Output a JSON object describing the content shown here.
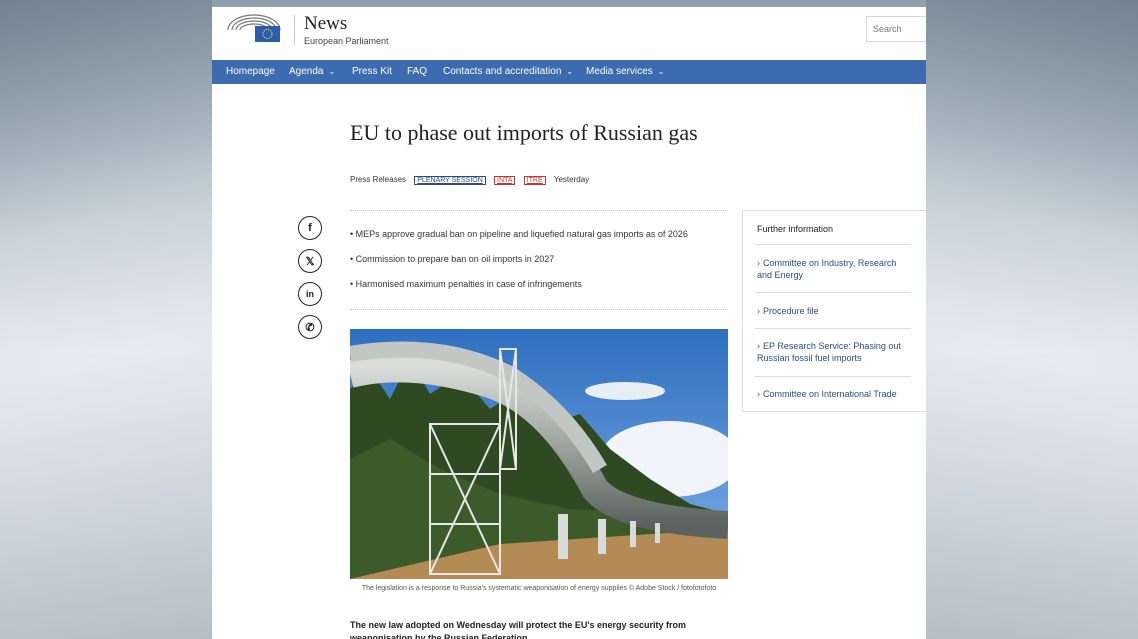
{
  "site": {
    "title": "News",
    "subtitle": "European Parliament"
  },
  "search": {
    "placeholder": "Search"
  },
  "nav": [
    {
      "label": "Homepage"
    },
    {
      "label": "Agenda"
    },
    {
      "label": "Press Kit"
    },
    {
      "label": "FAQ"
    },
    {
      "label": "Contacts and accreditation"
    },
    {
      "label": "Media services"
    }
  ],
  "article": {
    "title": "EU to phase out imports of Russian gas",
    "type": "Press Releases",
    "tags": [
      "PLENARY SESSION",
      "INTA",
      "ITRE"
    ],
    "date": "Yesterday",
    "bullets": [
      "MEPs approve gradual ban on pipeline and liquefied natural gas imports as of 2026",
      "Commission to prepare ban on oil imports in 2027",
      "Harmonised maximum penalties in case of infringements"
    ],
    "image_caption": "The legislation is a response to Russia's systematic weaponisation of energy supplies © Adobe Stock / fotofotofoto",
    "lead": "The new law adopted on Wednesday will protect the EU's energy security from weaponisation by the Russian Federation."
  },
  "share": [
    {
      "icon": "facebook-icon",
      "glyph": "f"
    },
    {
      "icon": "x-icon",
      "glyph": "𝕏"
    },
    {
      "icon": "linkedin-icon",
      "glyph": "in"
    },
    {
      "icon": "whatsapp-icon",
      "glyph": "✆"
    }
  ],
  "further_info": {
    "title": "Further information",
    "links": [
      "Committee on Industry, Research and Energy",
      "Procedure file",
      "EP Research Service: Phasing out Russian fossil fuel imports",
      "Committee on International Trade"
    ]
  },
  "colors": {
    "nav": "#3c6bb0",
    "link": "#2a4d8a",
    "tag_red": "#c0392b"
  }
}
